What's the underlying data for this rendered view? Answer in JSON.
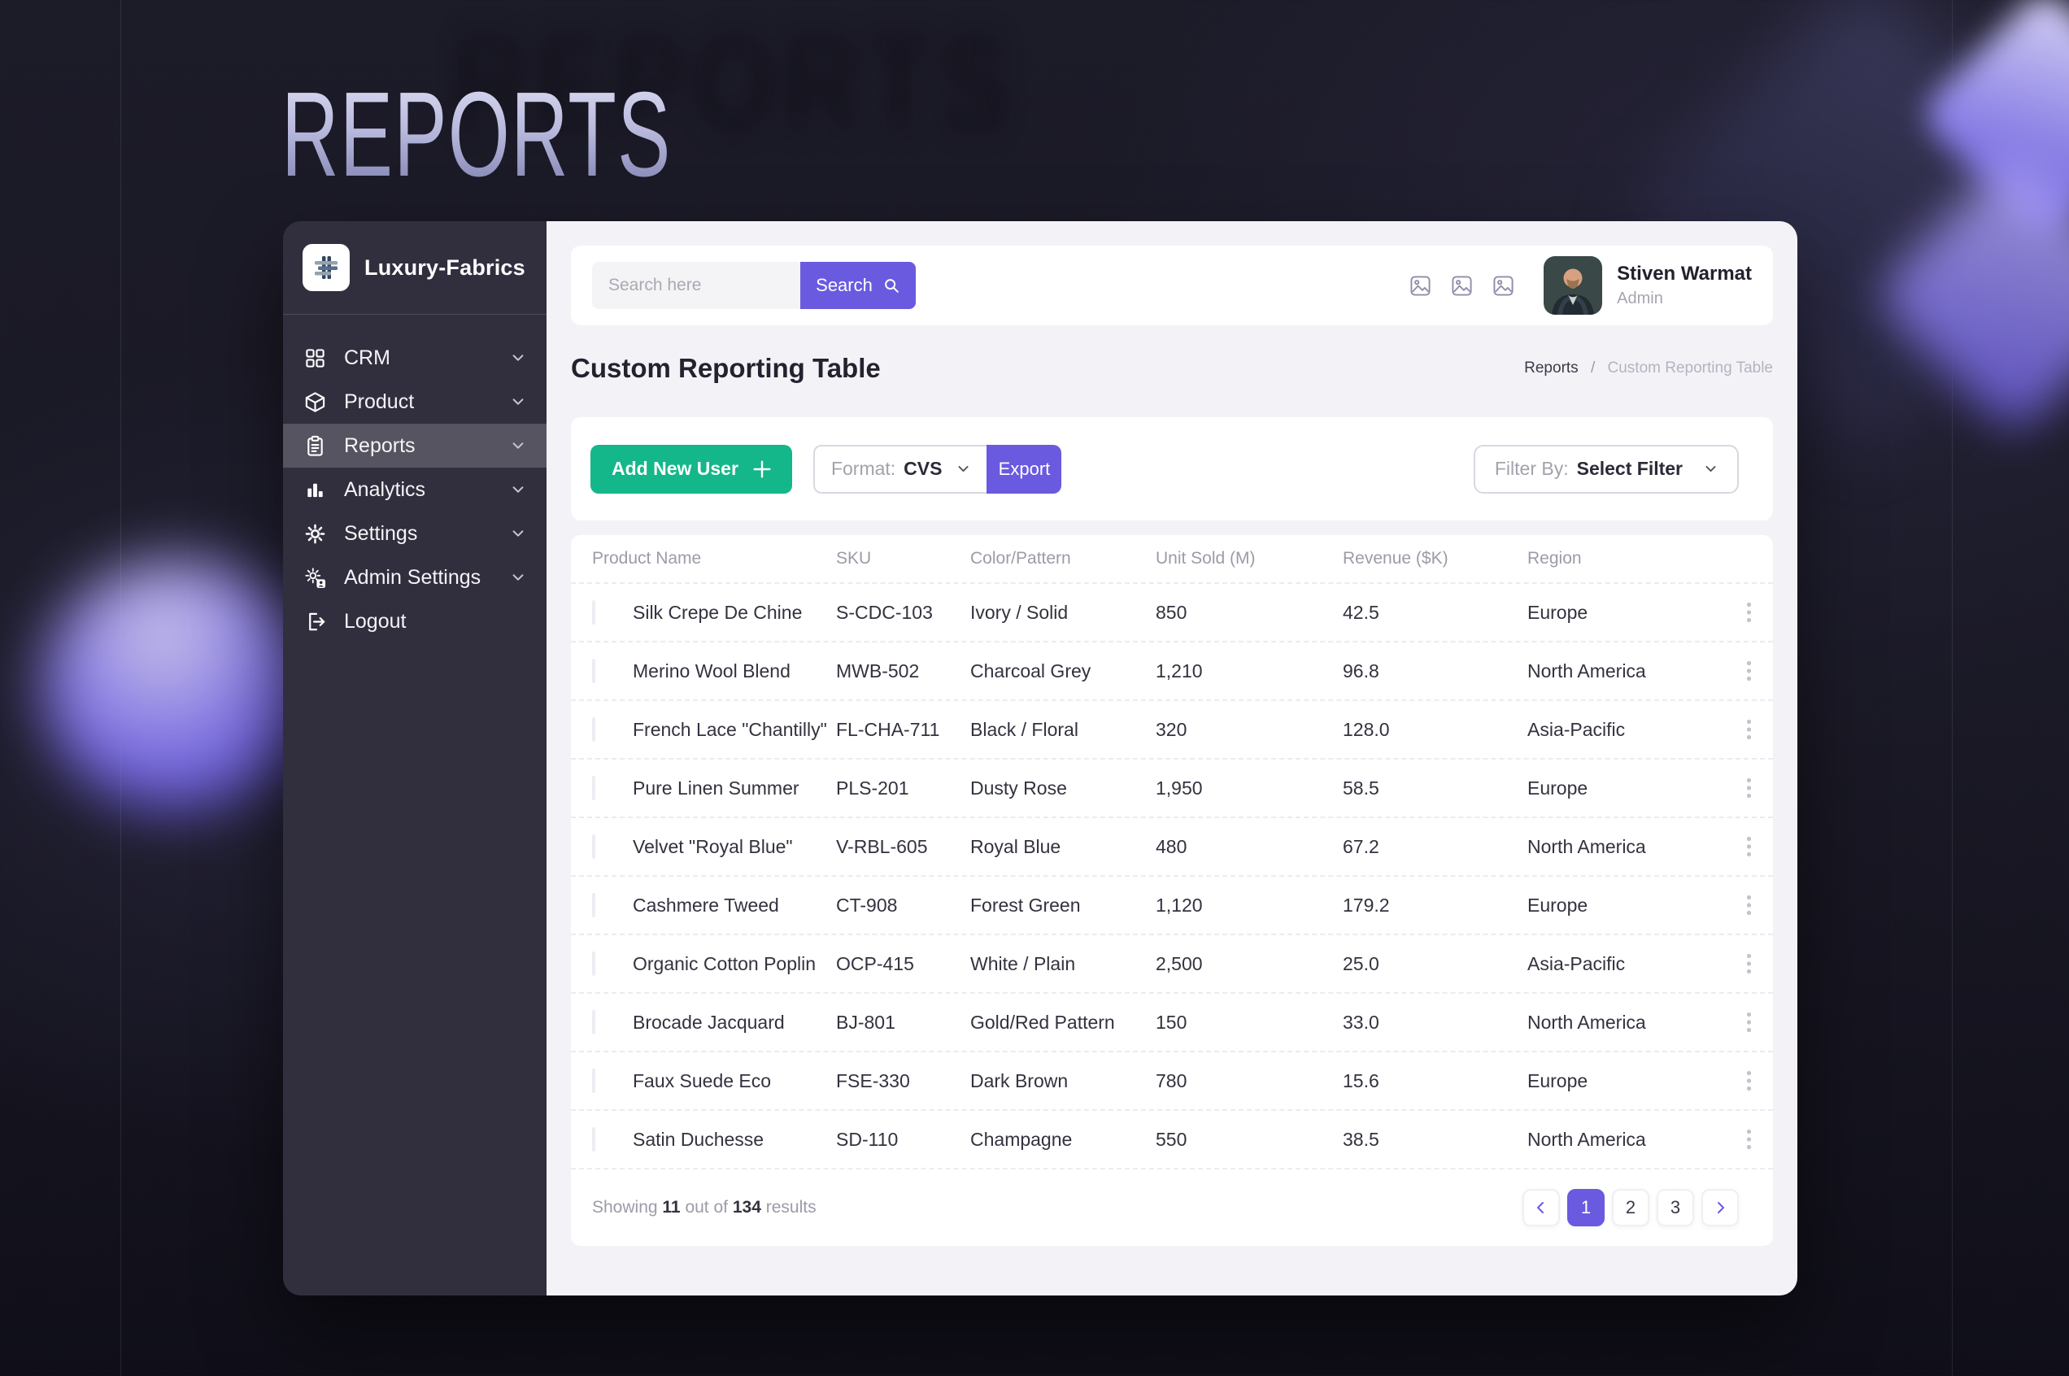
{
  "page": {
    "title": "REPORTS"
  },
  "colors": {
    "accent_purple": "#6a5ae0",
    "button_green": "#14b789",
    "sidebar_bg": "#312f3e",
    "content_bg": "#f3f3f7"
  },
  "sidebar": {
    "brand": {
      "name": "Luxury-Fabrics",
      "logo_icon": "fabric-weave"
    },
    "items": [
      {
        "label": "CRM",
        "icon": "grid-icon",
        "active": false,
        "chevron": true
      },
      {
        "label": "Product",
        "icon": "box-icon",
        "active": false,
        "chevron": true
      },
      {
        "label": "Reports",
        "icon": "clipboard-icon",
        "active": true,
        "chevron": true
      },
      {
        "label": "Analytics",
        "icon": "bar-chart-icon",
        "active": false,
        "chevron": true
      },
      {
        "label": "Settings",
        "icon": "gear-icon",
        "active": false,
        "chevron": true
      },
      {
        "label": "Admin Settings",
        "icon": "gear-user-icon",
        "active": false,
        "chevron": true
      },
      {
        "label": "Logout",
        "icon": "logout-icon",
        "active": false,
        "chevron": false
      }
    ]
  },
  "topbar": {
    "search_placeholder": "Search here",
    "search_button": "Search",
    "search_icon": "magnifier-icon",
    "action_icons": [
      "image-placeholder",
      "image-placeholder",
      "image-placeholder"
    ],
    "user": {
      "name": "Stiven Warmat",
      "role": "Admin",
      "avatar": "user-photo"
    }
  },
  "header": {
    "title": "Custom Reporting Table",
    "breadcrumb": {
      "root": "Reports",
      "separator": "/",
      "current": "Custom Reporting Table"
    }
  },
  "toolbar": {
    "add_user_label": "Add New User",
    "format_label": "Format:",
    "format_value": "CVS",
    "export_label": "Export",
    "filter_label": "Filter By:",
    "filter_value": "Select Filter"
  },
  "table": {
    "columns": [
      "Product Name",
      "SKU",
      "Color/Pattern",
      "Unit Sold (M)",
      "Revenue ($K)",
      "Region"
    ],
    "rows": [
      [
        "Silk Crepe De Chine",
        "S-CDC-103",
        "Ivory / Solid",
        "850",
        "42.5",
        "Europe"
      ],
      [
        "Merino Wool Blend",
        "MWB-502",
        "Charcoal Grey",
        "1,210",
        "96.8",
        "North America"
      ],
      [
        "French Lace \"Chantilly\"",
        "FL-CHA-711",
        "Black / Floral",
        "320",
        "128.0",
        "Asia-Pacific"
      ],
      [
        "Pure Linen Summer",
        "PLS-201",
        "Dusty Rose",
        "1,950",
        "58.5",
        "Europe"
      ],
      [
        "Velvet \"Royal Blue\"",
        "V-RBL-605",
        "Royal Blue",
        "480",
        "67.2",
        "North America"
      ],
      [
        "Cashmere Tweed",
        "CT-908",
        "Forest Green",
        "1,120",
        "179.2",
        "Europe"
      ],
      [
        "Organic Cotton Poplin",
        "OCP-415",
        "White / Plain",
        "2,500",
        "25.0",
        "Asia-Pacific"
      ],
      [
        "Brocade Jacquard",
        "BJ-801",
        "Gold/Red Pattern",
        "150",
        "33.0",
        "North America"
      ],
      [
        "Faux Suede Eco",
        "FSE-330",
        "Dark Brown",
        "780",
        "15.6",
        "Europe"
      ],
      [
        "Satin Duchesse",
        "SD-110",
        "Champagne",
        "550",
        "38.5",
        "North America"
      ]
    ]
  },
  "pagination": {
    "summary": {
      "prefix": "Showing",
      "shown": "11",
      "connector": "out of",
      "total": "134",
      "suffix": "results"
    },
    "pages": [
      "1",
      "2",
      "3"
    ],
    "active_page": "1",
    "prev_icon": "chevron-left",
    "next_icon": "chevron-right"
  }
}
